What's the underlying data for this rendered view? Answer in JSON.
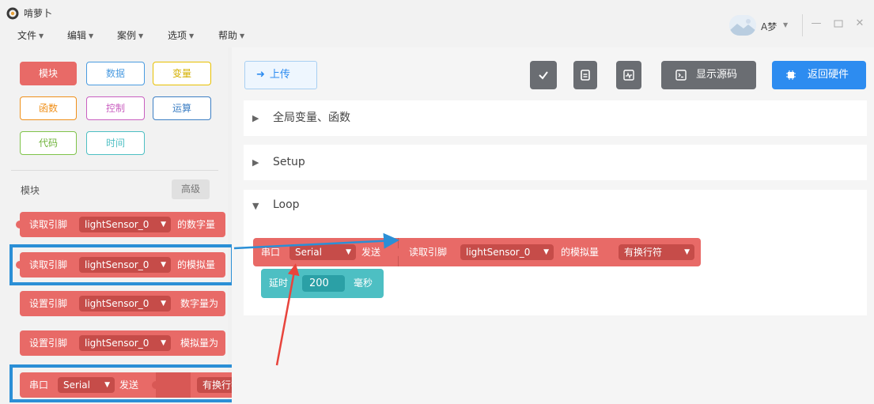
{
  "app": {
    "title": "啃萝卜"
  },
  "menu": [
    {
      "label": "文件"
    },
    {
      "label": "编辑"
    },
    {
      "label": "案例"
    },
    {
      "label": "选项"
    },
    {
      "label": "帮助"
    }
  ],
  "user": {
    "name": "A梦"
  },
  "categories": {
    "items": [
      {
        "label": "模块",
        "color": "#e86a67",
        "active": true
      },
      {
        "label": "数据",
        "color": "#4a9be0"
      },
      {
        "label": "变量",
        "color": "#e8c000"
      },
      {
        "label": "函数",
        "color": "#f0901a"
      },
      {
        "label": "控制",
        "color": "#c95fc0"
      },
      {
        "label": "运算",
        "color": "#3d7fc4"
      },
      {
        "label": "代码",
        "color": "#7fc34a"
      },
      {
        "label": "时间",
        "color": "#4dbfc3"
      }
    ]
  },
  "palette": {
    "title": "模块",
    "advanced": "高级",
    "blocks": [
      {
        "prefix": "读取引脚",
        "pin": "lightSensor_0",
        "suffix": "的数字量"
      },
      {
        "prefix": "读取引脚",
        "pin": "lightSensor_0",
        "suffix": "的模拟量"
      },
      {
        "prefix": "设置引脚",
        "pin": "lightSensor_0",
        "suffix": "数字量为"
      },
      {
        "prefix": "设置引脚",
        "pin": "lightSensor_0",
        "suffix": "模拟量为"
      }
    ],
    "serial_block": {
      "prefix": "串口",
      "port": "Serial",
      "send": "发送",
      "newline": "有换行符"
    }
  },
  "toolbar": {
    "upload": "上传",
    "show_source": "显示源码",
    "return_hardware": "返回硬件"
  },
  "sections": [
    {
      "title": "全局变量、函数"
    },
    {
      "title": "Setup"
    },
    {
      "title": "Loop"
    }
  ],
  "workspace": {
    "serial": {
      "prefix": "串口",
      "port": "Serial",
      "send": "发送",
      "newline": "有换行符"
    },
    "read": {
      "prefix": "读取引脚",
      "pin": "lightSensor_0",
      "suffix": "的模拟量"
    },
    "delay": {
      "prefix": "延时",
      "value": "200",
      "unit": "毫秒"
    }
  },
  "colors": {
    "block_red": "#e86a67",
    "dropdown_red": "#c64c49",
    "block_teal": "#4dbfc3",
    "accent_blue": "#2d8cf0",
    "highlight_blue": "#2b8fd6",
    "annotation_red": "#e8443c"
  }
}
